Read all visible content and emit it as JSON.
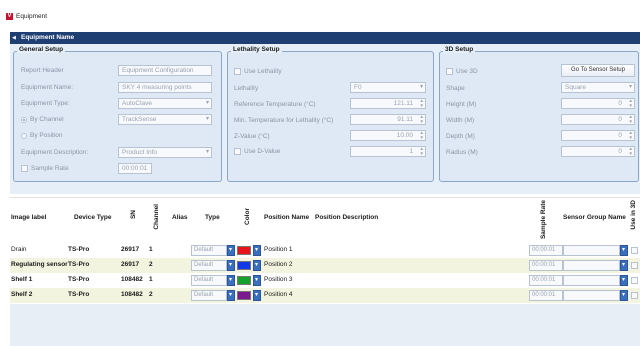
{
  "window": {
    "title": "Equipment",
    "icon": "app-logo-icon"
  },
  "header": {
    "title": "Equipment Name"
  },
  "general": {
    "legend": "General Setup",
    "report_header": {
      "label": "Report Header",
      "value": "Equipment Configuration"
    },
    "equipment_name": {
      "label": "Equipment Name:",
      "value": "SKY 4 measuring points"
    },
    "equipment_type": {
      "label": "Equipment Type:",
      "value": "AutoClave"
    },
    "by_channel": {
      "label": "By Channel",
      "value": "TrackSense"
    },
    "by_position": {
      "label": "By Position"
    },
    "equipment_description": {
      "label": "Equipment Description:",
      "value": "Product Info"
    },
    "sample_rate": {
      "label": "Sample Rate",
      "value": "00:00:01"
    }
  },
  "lethality": {
    "legend": "Lethality Setup",
    "use_lethality": "Use Lethality",
    "lethality": {
      "label": "Lethality",
      "value": "F0"
    },
    "reference_temperature": {
      "label": "Reference Temperature (°C)",
      "value": "121.11"
    },
    "min_temperature": {
      "label": "Min. Temperature for Lethality (°C)",
      "value": "91.11"
    },
    "z_value": {
      "label": "Z-Value (°C)",
      "value": "10.00"
    },
    "use_d_value": {
      "label": "Use D-Value",
      "value": "1"
    }
  },
  "setup3d": {
    "legend": "3D Setup",
    "use_3d": "Use 3D",
    "go_to_sensor_setup": "Go To Sensor Setup",
    "shape": {
      "label": "Shape",
      "value": "Square"
    },
    "height": {
      "label": "Height (M)",
      "value": "0"
    },
    "width": {
      "label": "Width (M)",
      "value": "0"
    },
    "depth": {
      "label": "Depth (M)",
      "value": "0"
    },
    "radius": {
      "label": "Radius (M)",
      "value": "0"
    }
  },
  "grid": {
    "columns": {
      "image_label": "Image label",
      "device_type": "Device Type",
      "sn": "SN",
      "channel": "Channel",
      "alias": "Alias",
      "type": "Type",
      "color": "Color",
      "position_name": "Position Name",
      "position_description": "Position Description",
      "sample_rate": "Sample Rate",
      "sensor_group_name": "Sensor Group Name",
      "use_in_3d": "Use in 3D"
    },
    "rows": [
      {
        "image_label": "Drain",
        "device_type": "TS-Pro",
        "sn": "26917",
        "channel": "1",
        "type": "Default",
        "color": "#e8141b",
        "position_name": "Position 1",
        "sample_rate": "00:00:01"
      },
      {
        "image_label": "Regulating sensor",
        "device_type": "TS-Pro",
        "sn": "26917",
        "channel": "2",
        "type": "Default",
        "color": "#1239e6",
        "position_name": "Position 2",
        "sample_rate": "00:00:01"
      },
      {
        "image_label": "Shelf 1",
        "device_type": "TS-Pro",
        "sn": "108482",
        "channel": "1",
        "type": "Default",
        "color": "#16a12a",
        "position_name": "Position 3",
        "sample_rate": "00:00:01"
      },
      {
        "image_label": "Shelf 2",
        "device_type": "TS-Pro",
        "sn": "108482",
        "channel": "2",
        "type": "Default",
        "color": "#7a1a8c",
        "position_name": "Position 4",
        "sample_rate": "00:00:01"
      }
    ]
  }
}
